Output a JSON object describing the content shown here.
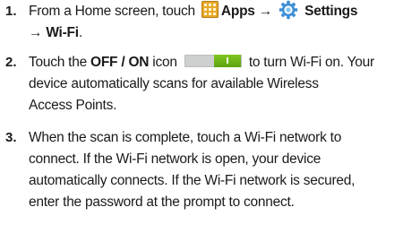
{
  "steps": [
    {
      "number": "1.",
      "line1": {
        "pre": "From a Home screen, touch",
        "apps": "Apps",
        "arrow1": "→",
        "settings": "Settings"
      },
      "line2": {
        "arrow2": "→",
        "wifi": "Wi-Fi",
        "period": "."
      }
    },
    {
      "number": "2.",
      "line1": {
        "pre": "Touch the",
        "offon": "OFF / ON",
        "mid": "icon",
        "post": "to turn Wi-Fi on. Your"
      },
      "line2": "device automatically scans for available Wireless",
      "line3": "Access Points."
    },
    {
      "number": "3.",
      "lines": [
        "When the scan is complete, touch a Wi-Fi network to",
        "connect. If the Wi-Fi network is open, your device",
        "automatically connects. If the Wi-Fi network is secured,",
        "enter the password at the prompt to connect."
      ]
    }
  ],
  "icons": {
    "apps": "apps-grid-icon",
    "settings": "settings-gear-icon",
    "toggle": "toggle-on-icon",
    "apps_color": "#e7a92a",
    "gear_color": "#3f8fd6",
    "toggle_color": "#6db41a"
  }
}
